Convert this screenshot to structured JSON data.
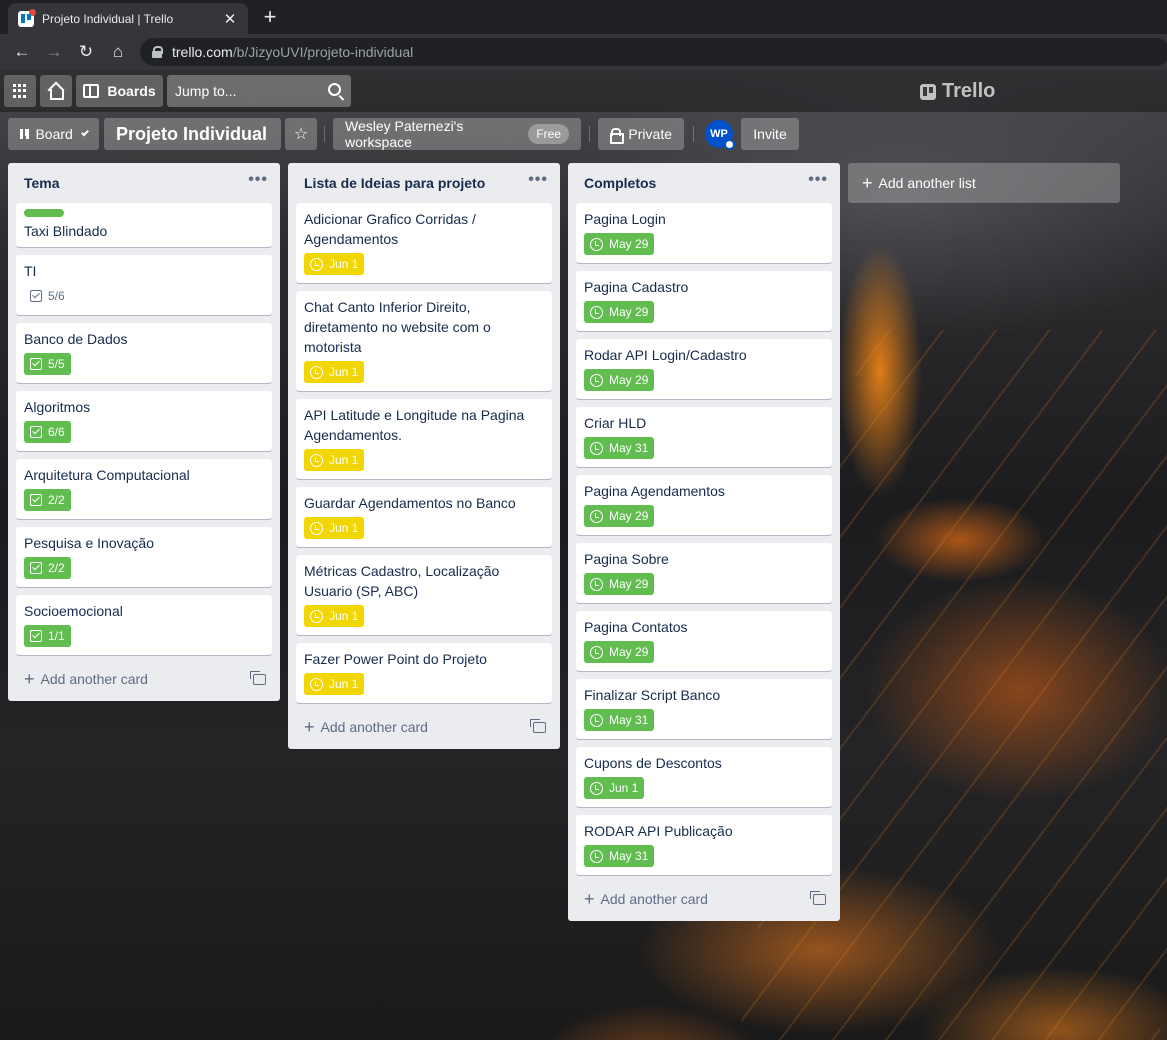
{
  "browser": {
    "tab_title": "Projeto Individual | Trello",
    "url_host": "trello.com",
    "url_path": "/b/JizyoUVI/projeto-individual"
  },
  "header": {
    "boards_label": "Boards",
    "jump_placeholder": "Jump to...",
    "brand": "Trello"
  },
  "board": {
    "view_label": "Board",
    "title": "Projeto Individual",
    "workspace": "Wesley Paternezi's workspace",
    "workspace_badge": "Free",
    "visibility": "Private",
    "avatar_initials": "WP",
    "invite_label": "Invite",
    "add_list_label": "Add another list",
    "add_card_label": "Add another card"
  },
  "lists": [
    {
      "title": "Tema",
      "cards": [
        {
          "title": "Taxi Blindado",
          "label_color": "#61bd4f"
        },
        {
          "title": "TI",
          "checklist": "5/6",
          "checklist_complete": false
        },
        {
          "title": "Banco de Dados",
          "checklist": "5/5",
          "checklist_complete": true
        },
        {
          "title": "Algoritmos",
          "checklist": "6/6",
          "checklist_complete": true
        },
        {
          "title": "Arquitetura Computacional",
          "checklist": "2/2",
          "checklist_complete": true
        },
        {
          "title": "Pesquisa e Inovação",
          "checklist": "2/2",
          "checklist_complete": true
        },
        {
          "title": "Socioemocional",
          "checklist": "1/1",
          "checklist_complete": true
        }
      ]
    },
    {
      "title": "Lista de Ideias para projeto",
      "cards": [
        {
          "title": "Adicionar Grafico Corridas / Agendamentos",
          "due": "Jun 1",
          "due_color": "yellow"
        },
        {
          "title": "Chat Canto Inferior Direito, diretamento no website com o motorista",
          "due": "Jun 1",
          "due_color": "yellow"
        },
        {
          "title": "API Latitude e Longitude na Pagina Agendamentos.",
          "due": "Jun 1",
          "due_color": "yellow"
        },
        {
          "title": "Guardar Agendamentos no Banco",
          "due": "Jun 1",
          "due_color": "yellow"
        },
        {
          "title": "Métricas Cadastro, Localização Usuario (SP, ABC)",
          "due": "Jun 1",
          "due_color": "yellow"
        },
        {
          "title": "Fazer Power Point do Projeto",
          "due": "Jun 1",
          "due_color": "yellow"
        }
      ]
    },
    {
      "title": "Completos",
      "cards": [
        {
          "title": "Pagina Login",
          "due": "May 29",
          "due_color": "green"
        },
        {
          "title": "Pagina Cadastro",
          "due": "May 29",
          "due_color": "green"
        },
        {
          "title": "Rodar API Login/Cadastro",
          "due": "May 29",
          "due_color": "green"
        },
        {
          "title": "Criar HLD",
          "due": "May 31",
          "due_color": "green"
        },
        {
          "title": "Pagina Agendamentos",
          "due": "May 29",
          "due_color": "green"
        },
        {
          "title": "Pagina Sobre",
          "due": "May 29",
          "due_color": "green"
        },
        {
          "title": "Pagina Contatos",
          "due": "May 29",
          "due_color": "green"
        },
        {
          "title": "Finalizar Script Banco",
          "due": "May 31",
          "due_color": "green"
        },
        {
          "title": "Cupons de Descontos",
          "due": "Jun 1",
          "due_color": "green"
        },
        {
          "title": "RODAR API Publicação",
          "due": "May 31",
          "due_color": "green"
        }
      ]
    }
  ]
}
